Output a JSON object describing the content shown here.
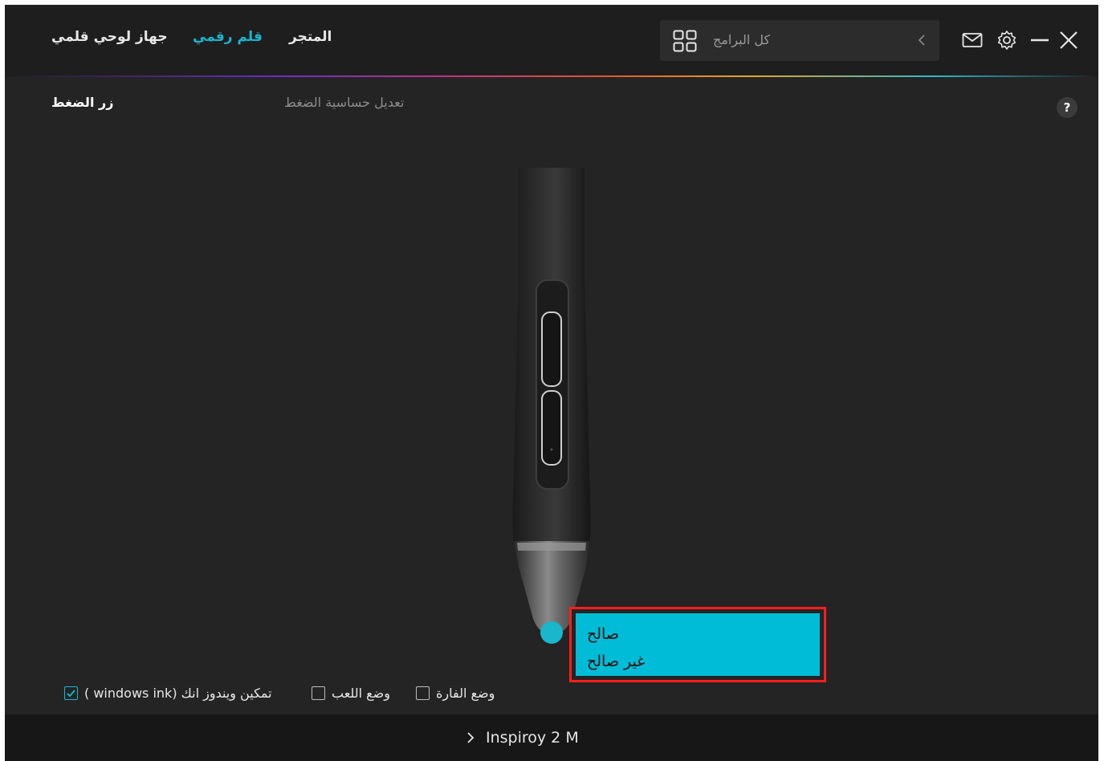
{
  "header": {
    "nav": {
      "tablet": "جهاز لوحي قلمي",
      "pen": "قلم رقمي",
      "store": "المتجر"
    },
    "app_switcher_label": "كل البرامج",
    "icons": [
      "grid-icon",
      "chevron-left-icon",
      "mail-icon",
      "gear-icon",
      "minimize-icon",
      "close-icon"
    ]
  },
  "subtabs": {
    "press_button": "زر الضغط",
    "pressure_sensitivity": "تعديل حساسية الضغط",
    "help": "?"
  },
  "dropdown": {
    "options": [
      "صالح",
      "غير صالح"
    ]
  },
  "options": {
    "windows_ink": {
      "label": "تمكين ويندوز انك (windows ink )",
      "checked": true
    },
    "game_mode": {
      "label": "وضع اللعب",
      "checked": false
    },
    "mouse_mode": {
      "label": "وضع الفارة",
      "checked": false
    }
  },
  "footer": {
    "device": "Inspiroy 2 M"
  },
  "colors": {
    "accent": "#19b6cc",
    "dropdown_bg": "#01bcd6",
    "highlight_border": "#ff1e1e",
    "background": "#242424"
  }
}
